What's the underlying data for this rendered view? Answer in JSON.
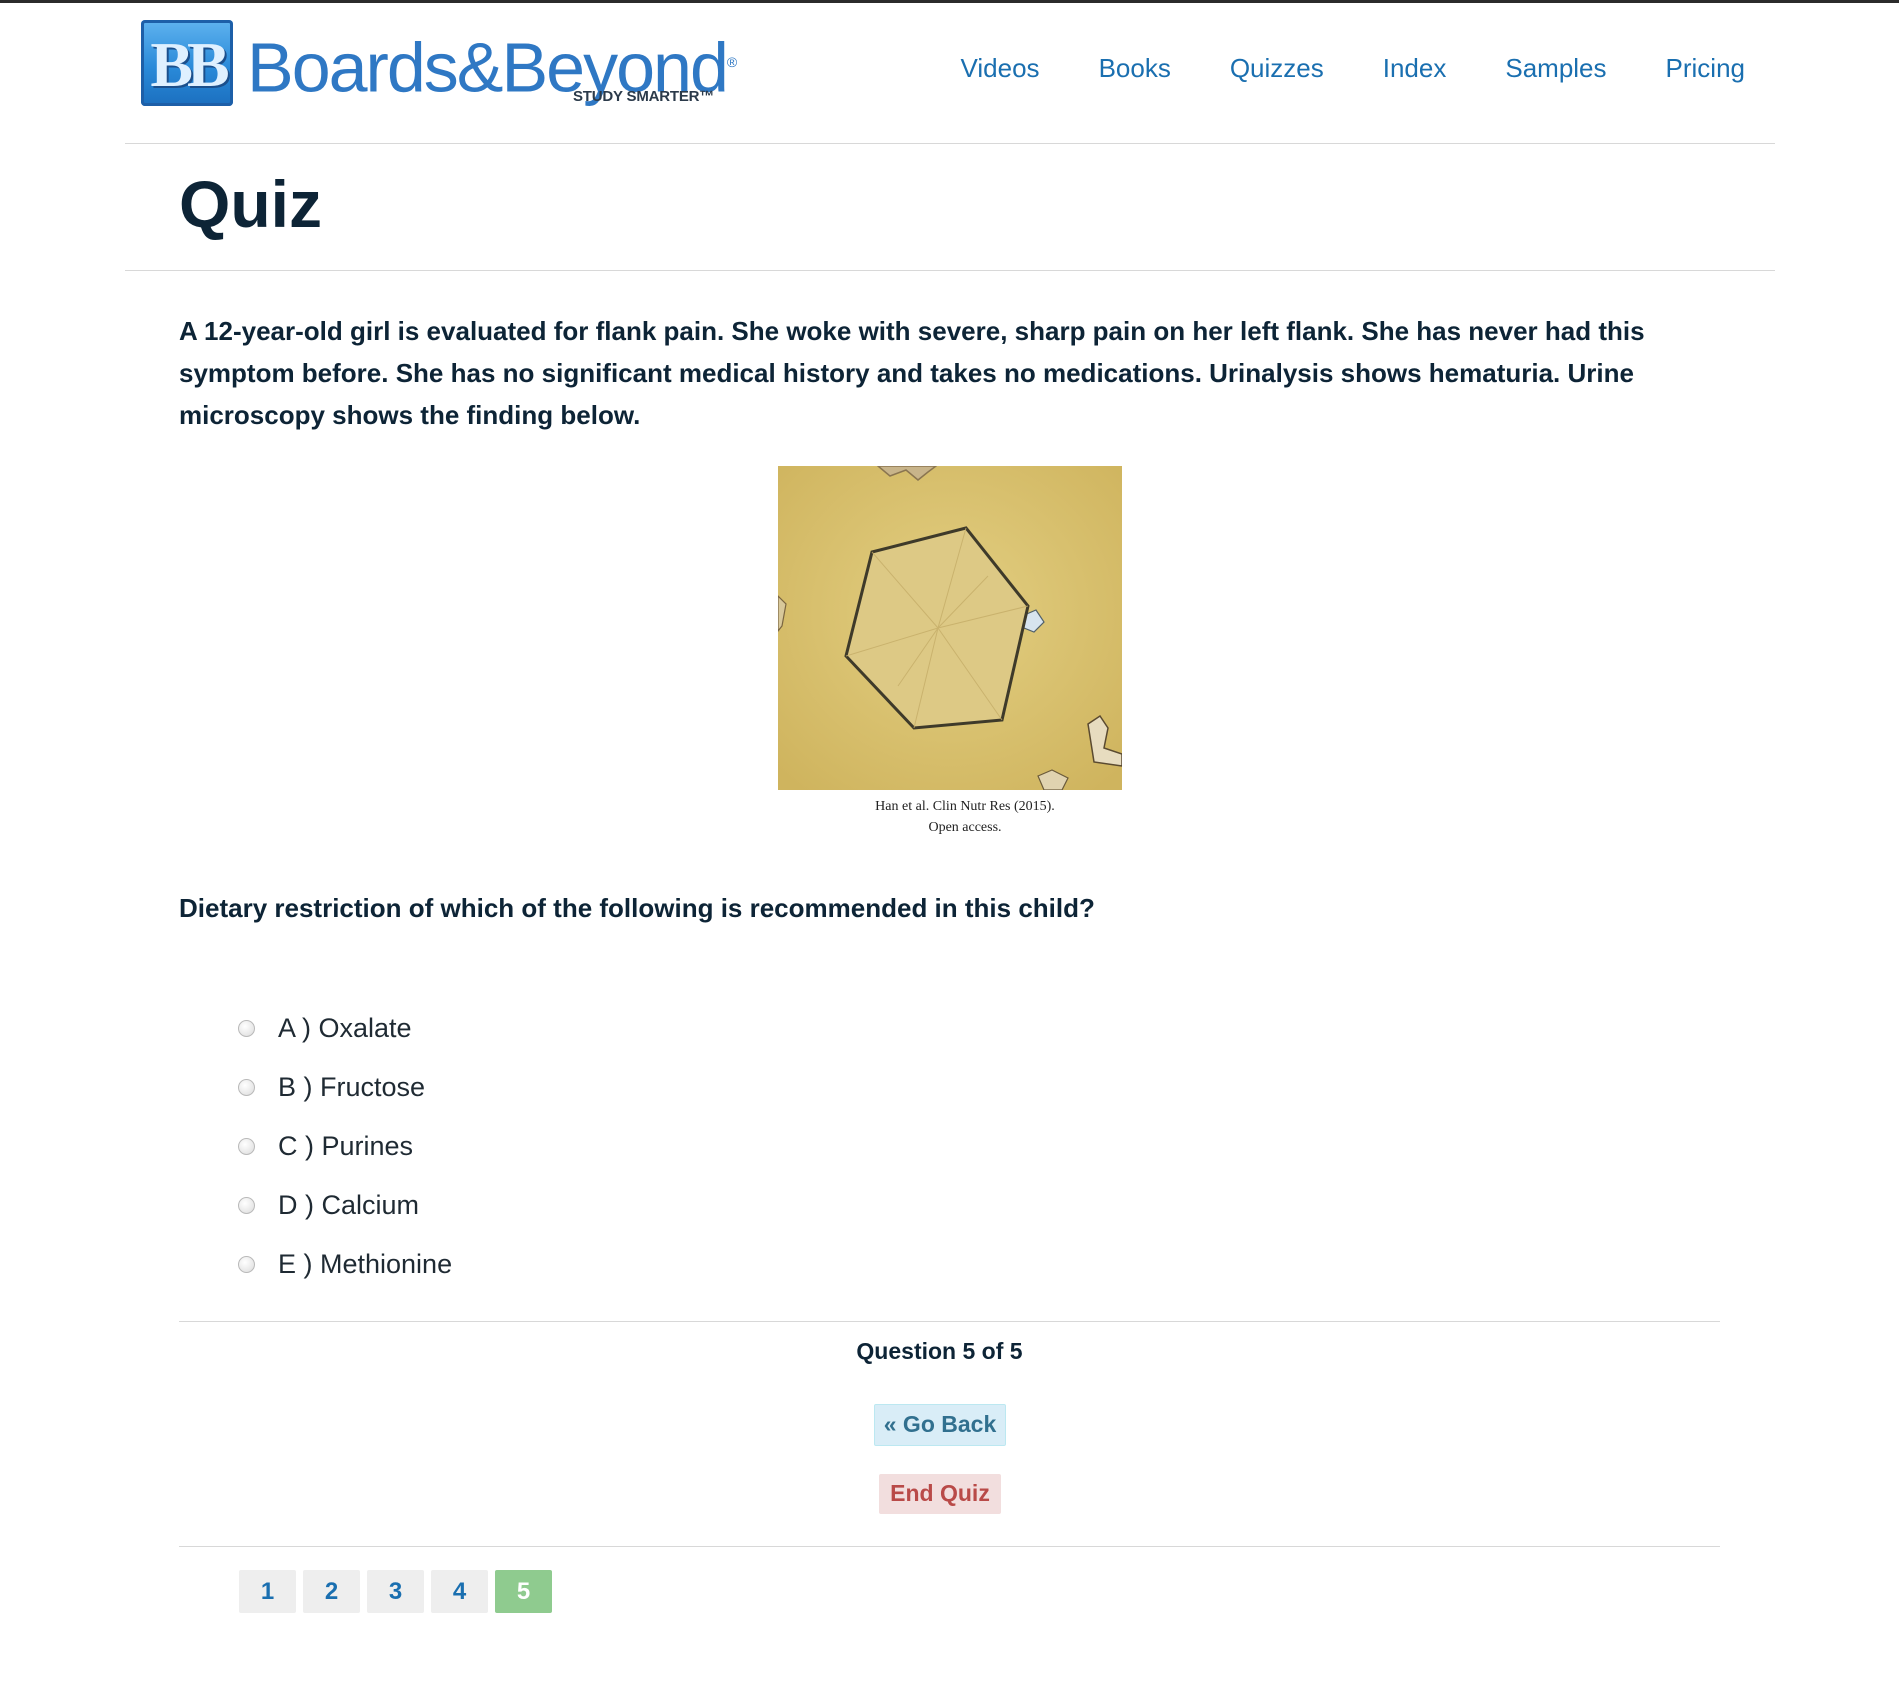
{
  "brand": {
    "mark": "BB",
    "name": "Boards&Beyond",
    "registered": "®",
    "tagline": "STUDY SMARTER™",
    "colors": {
      "primary": "#2f78c4",
      "nav": "#1a6fb0",
      "text": "#0d2436"
    }
  },
  "nav": [
    "Videos",
    "Books",
    "Quizzes",
    "Index",
    "Samples",
    "Pricing"
  ],
  "page_title": "Quiz",
  "question_stem": "A 12-year-old girl is evaluated for flank pain. She woke with severe, sharp pain on her left flank. She has never had this symptom before. She has no significant medical history and takes no medications. Urinalysis shows hematuria. Urine microscopy shows the finding below.",
  "figure": {
    "caption_line1": "Han et al. Clin Nutr Res (2015).",
    "caption_line2": "Open access."
  },
  "question": "Dietary restriction of which of the following is recommended in this child?",
  "choices": [
    {
      "label": "A ) Oxalate",
      "selected": false
    },
    {
      "label": "B ) Fructose",
      "selected": false
    },
    {
      "label": "C ) Purines",
      "selected": false
    },
    {
      "label": "D ) Calcium",
      "selected": false
    },
    {
      "label": "E ) Methionine",
      "selected": false
    }
  ],
  "progress_text": "Question 5 of 5",
  "buttons": {
    "go_back": "« Go Back",
    "end_quiz": "End Quiz"
  },
  "pager": {
    "pages": [
      "1",
      "2",
      "3",
      "4",
      "5"
    ],
    "current": "5"
  }
}
